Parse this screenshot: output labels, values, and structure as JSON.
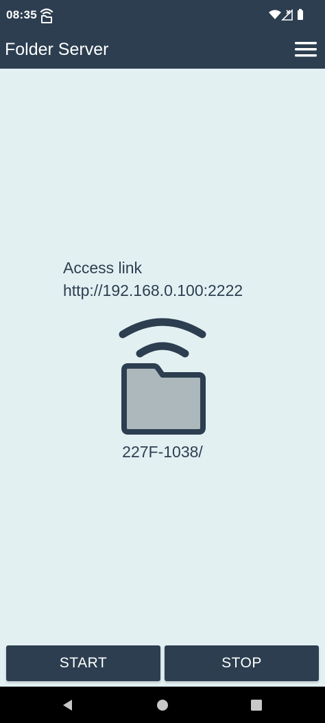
{
  "status_bar": {
    "time": "08:35",
    "left_icon": "wifi-share-icon",
    "right_icons": [
      "wifi-icon",
      "no-signal-icon",
      "battery-icon"
    ]
  },
  "app_bar": {
    "title": "Folder Server",
    "menu_icon": "hamburger-menu-icon"
  },
  "main": {
    "access_label": "Access link",
    "access_url": "http://192.168.0.100:2222",
    "folder_icon": "shared-folder-icon",
    "folder_path": "227F-1038/"
  },
  "actions": {
    "start_label": "START",
    "stop_label": "STOP"
  },
  "nav_bar": {
    "icons": [
      "back-icon",
      "home-icon",
      "recents-icon"
    ]
  },
  "colors": {
    "primary": "#2c3e50",
    "background": "#e3f0f2",
    "folder_fill": "#adb8bd"
  }
}
